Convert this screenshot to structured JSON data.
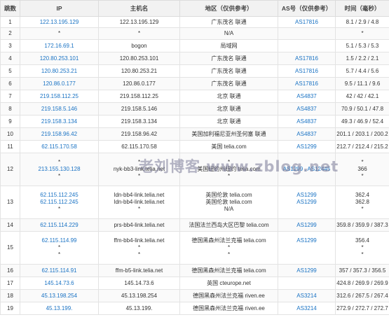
{
  "headers": {
    "hop": "跳数",
    "ip": "IP",
    "host": "主机名",
    "region": "地区（仅供参考）",
    "asn": "AS号（仅供参考）",
    "time": "时间（毫秒）"
  },
  "rows": [
    {
      "hop": "1",
      "ip": [
        "122.13.195.129"
      ],
      "host": [
        "122.13.195.129"
      ],
      "region": [
        "广东茂名 联通"
      ],
      "asn": [
        "AS17816"
      ],
      "time": [
        "8.1 / 2.9 / 4.8"
      ]
    },
    {
      "hop": "2",
      "ip": [
        "*"
      ],
      "host": [
        "*"
      ],
      "region": [
        "N/A"
      ],
      "asn": [
        ""
      ],
      "time": [
        "*"
      ]
    },
    {
      "hop": "3",
      "ip": [
        "172.16.69.1"
      ],
      "host": [
        "bogon"
      ],
      "region": [
        "局域网"
      ],
      "asn": [
        ""
      ],
      "time": [
        "5.1 / 5.3 / 5.3"
      ]
    },
    {
      "hop": "4",
      "ip": [
        "120.80.253.101"
      ],
      "host": [
        "120.80.253.101"
      ],
      "region": [
        "广东茂名 联通"
      ],
      "asn": [
        "AS17816"
      ],
      "time": [
        "1.5 / 2.2 / 2.1"
      ]
    },
    {
      "hop": "5",
      "ip": [
        "120.80.253.21"
      ],
      "host": [
        "120.80.253.21"
      ],
      "region": [
        "广东茂名 联通"
      ],
      "asn": [
        "AS17816"
      ],
      "time": [
        "5.7 / 4.4 / 5.6"
      ]
    },
    {
      "hop": "6",
      "ip": [
        "120.86.0.177"
      ],
      "host": [
        "120.86.0.177"
      ],
      "region": [
        "广东茂名 联通"
      ],
      "asn": [
        "AS17816"
      ],
      "time": [
        "9.5 / 11.1 / 9.6"
      ]
    },
    {
      "hop": "7",
      "ip": [
        "219.158.112.25"
      ],
      "host": [
        "219.158.112.25"
      ],
      "region": [
        "北京 联通"
      ],
      "asn": [
        "AS4837"
      ],
      "time": [
        "42 / 42 / 42.1"
      ]
    },
    {
      "hop": "8",
      "ip": [
        "219.158.5.146"
      ],
      "host": [
        "219.158.5.146"
      ],
      "region": [
        "北京 联通"
      ],
      "asn": [
        "AS4837"
      ],
      "time": [
        "70.9 / 50.1 / 47.8"
      ]
    },
    {
      "hop": "9",
      "ip": [
        "219.158.3.134"
      ],
      "host": [
        "219.158.3.134"
      ],
      "region": [
        "北京 联通"
      ],
      "asn": [
        "AS4837"
      ],
      "time": [
        "49.3 / 46.9 / 52.4"
      ]
    },
    {
      "hop": "10",
      "ip": [
        "219.158.96.42"
      ],
      "host": [
        "219.158.96.42"
      ],
      "region": [
        "美国加利福尼亚州圣何塞 联通"
      ],
      "asn": [
        "AS4837"
      ],
      "time": [
        "201.1 / 203.1 / 200.2"
      ]
    },
    {
      "hop": "11",
      "ip": [
        "62.115.170.58"
      ],
      "host": [
        "62.115.170.58"
      ],
      "region": [
        "美国 telia.com"
      ],
      "asn": [
        "AS1299"
      ],
      "time": [
        "212.7 / 212.4 / 215.2"
      ]
    },
    {
      "hop": "12",
      "ip": [
        "*",
        "213.155.130.128",
        "*"
      ],
      "host": [
        "*",
        "nyk-bb3-link.telia.net",
        "*"
      ],
      "region": [
        "*",
        "美国纽约州纽约 telia.com",
        "*"
      ],
      "asn": [
        "",
        "AS1299 , AS12445",
        ""
      ],
      "time": [
        "*",
        "366",
        "*"
      ]
    },
    {
      "hop": "13",
      "ip": [
        "62.115.112.245",
        "62.115.112.245",
        "*"
      ],
      "host": [
        "ldn-bb4-link.telia.net",
        "ldn-bb4-link.telia.net",
        "*"
      ],
      "region": [
        "英国伦敦 telia.com",
        "英国伦敦 telia.com",
        "N/A"
      ],
      "asn": [
        "AS1299",
        "AS1299",
        ""
      ],
      "time": [
        "362.4",
        "362.8",
        "*"
      ]
    },
    {
      "hop": "14",
      "ip": [
        "62.115.114.229"
      ],
      "host": [
        "prs-bb4-link.telia.net"
      ],
      "region": [
        "法国法兰西岛大区巴黎 telia.com"
      ],
      "asn": [
        "AS1299"
      ],
      "time": [
        "359.8 / 359.9 / 387.3"
      ]
    },
    {
      "hop": "15",
      "ip": [
        "62.115.114.99",
        "*",
        "*"
      ],
      "host": [
        "ffm-bb4-link.telia.net",
        "*",
        "*"
      ],
      "region": [
        "德国黑森州法兰克福 telia.com",
        "*",
        "*"
      ],
      "asn": [
        "AS1299",
        "",
        ""
      ],
      "time": [
        "356.4",
        "*",
        "*"
      ]
    },
    {
      "hop": "16",
      "ip": [
        "62.115.114.91"
      ],
      "host": [
        "ffm-b5-link.telia.net"
      ],
      "region": [
        "德国黑森州法兰克福 telia.com"
      ],
      "asn": [
        "AS1299"
      ],
      "time": [
        "357 / 357.3 / 356.5"
      ]
    },
    {
      "hop": "17",
      "ip": [
        "145.14.73.6"
      ],
      "host": [
        "145.14.73.6"
      ],
      "region": [
        "英国 cteurope.net"
      ],
      "asn": [
        ""
      ],
      "time": [
        "424.8 / 269.9 / 269.9"
      ]
    },
    {
      "hop": "18",
      "ip": [
        "45.13.198.254"
      ],
      "host": [
        "45.13.198.254"
      ],
      "region": [
        "德国黑森州法兰克福 riven.ee"
      ],
      "asn": [
        "AS3214"
      ],
      "time": [
        "312.6 / 267.5 / 267.4"
      ]
    },
    {
      "hop": "19",
      "ip": [
        "45.13.199."
      ],
      "host": [
        "45.13.199."
      ],
      "region": [
        "德国黑森州法兰克福 riven.ee"
      ],
      "asn": [
        "AS3214"
      ],
      "time": [
        "272.9 / 272.7 / 272.7"
      ]
    }
  ],
  "watermark": "老刘博客 www.zblog.net",
  "colors": {
    "link": "#1a73c4",
    "header_bg": "#f2f2f2",
    "border": "#e3e3e3",
    "text": "#333333"
  }
}
